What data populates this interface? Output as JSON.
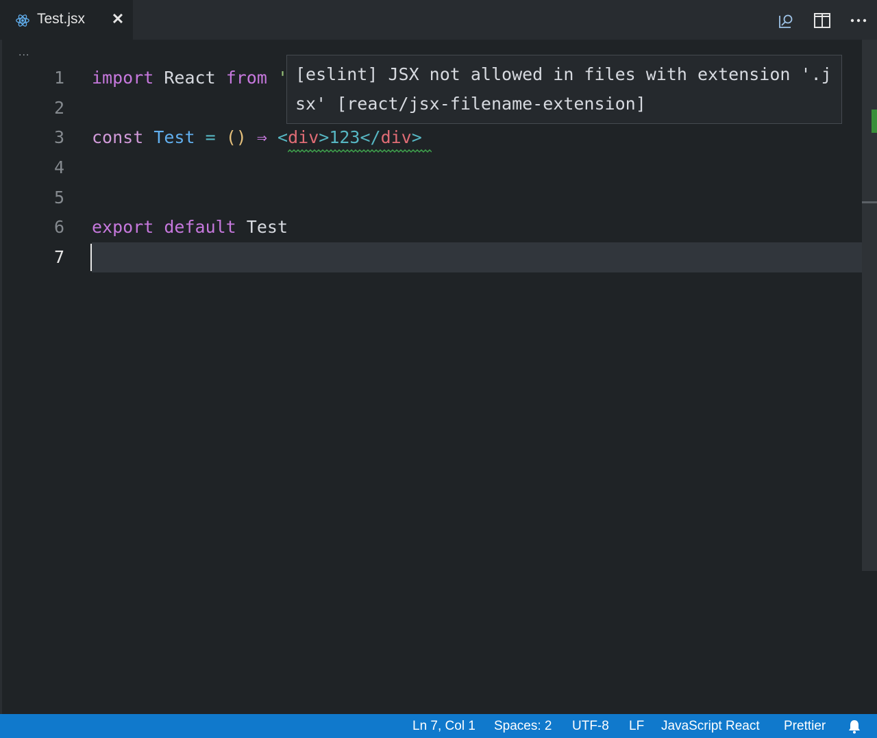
{
  "tab": {
    "title": "Test.jsx",
    "close_glyph": "✕",
    "icon": "react-icon"
  },
  "actions": [
    {
      "name": "open-preview-icon"
    },
    {
      "name": "split-editor-icon"
    },
    {
      "name": "more-actions-icon"
    }
  ],
  "breadcrumb": {
    "ellipsis": "..."
  },
  "editor": {
    "line_numbers": [
      "1",
      "2",
      "3",
      "4",
      "5",
      "6",
      "7"
    ],
    "active_line": "7",
    "lines": {
      "l1": {
        "kw_import": "import",
        "ident_react": "React",
        "kw_from": "from",
        "str_quote": "'"
      },
      "l3": {
        "kw_const": "const",
        "ident_test": "Test",
        "op_eq": "=",
        "parens": "()",
        "arrow": "⇒",
        "tag_open_lt": "<",
        "tag_open_name": "div",
        "tag_open_gt": ">",
        "text": "123",
        "tag_close_lt": "</",
        "tag_close_name": "div",
        "tag_close_gt": ">"
      },
      "l6": {
        "kw_export": "export",
        "kw_default": "default",
        "ident_test": "Test"
      }
    }
  },
  "hover": {
    "message": "[eslint] JSX not allowed in files with extension '.jsx' [react/jsx-filename-extension]"
  },
  "statusbar": {
    "position": "Ln 7, Col 1",
    "spaces": "Spaces: 2",
    "encoding": "UTF-8",
    "eol": "LF",
    "language": "JavaScript React",
    "formatter": "Prettier",
    "notifications_icon": "bell-icon"
  },
  "colors": {
    "editor_bg": "#1f2326",
    "statusbar_bg": "#1079cc",
    "keyword": "#c678dd",
    "function": "#61afef",
    "tag": "#e06c75",
    "squiggle": "#3fa34d"
  }
}
